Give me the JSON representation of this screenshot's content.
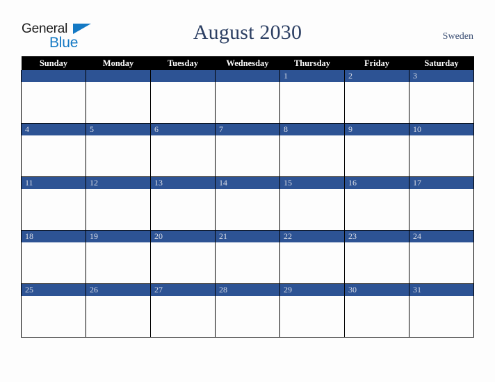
{
  "brand": {
    "name_part1": "General",
    "name_part2": "Blue",
    "accent_color": "#1479c4"
  },
  "header": {
    "title": "August 2030",
    "country": "Sweden",
    "title_color": "#2c3f63"
  },
  "calendar": {
    "month": "August",
    "year": "2030",
    "weekdays": [
      "Sunday",
      "Monday",
      "Tuesday",
      "Wednesday",
      "Thursday",
      "Friday",
      "Saturday"
    ],
    "header_background": "#000000",
    "daybar_color": "#2d5394",
    "daynumber_color": "#d9dce6",
    "weeks": [
      [
        {
          "day": ""
        },
        {
          "day": ""
        },
        {
          "day": ""
        },
        {
          "day": ""
        },
        {
          "day": "1"
        },
        {
          "day": "2"
        },
        {
          "day": "3"
        }
      ],
      [
        {
          "day": "4"
        },
        {
          "day": "5"
        },
        {
          "day": "6"
        },
        {
          "day": "7"
        },
        {
          "day": "8"
        },
        {
          "day": "9"
        },
        {
          "day": "10"
        }
      ],
      [
        {
          "day": "11"
        },
        {
          "day": "12"
        },
        {
          "day": "13"
        },
        {
          "day": "14"
        },
        {
          "day": "15"
        },
        {
          "day": "16"
        },
        {
          "day": "17"
        }
      ],
      [
        {
          "day": "18"
        },
        {
          "day": "19"
        },
        {
          "day": "20"
        },
        {
          "day": "21"
        },
        {
          "day": "22"
        },
        {
          "day": "23"
        },
        {
          "day": "24"
        }
      ],
      [
        {
          "day": "25"
        },
        {
          "day": "26"
        },
        {
          "day": "27"
        },
        {
          "day": "28"
        },
        {
          "day": "29"
        },
        {
          "day": "30"
        },
        {
          "day": "31"
        }
      ]
    ]
  }
}
